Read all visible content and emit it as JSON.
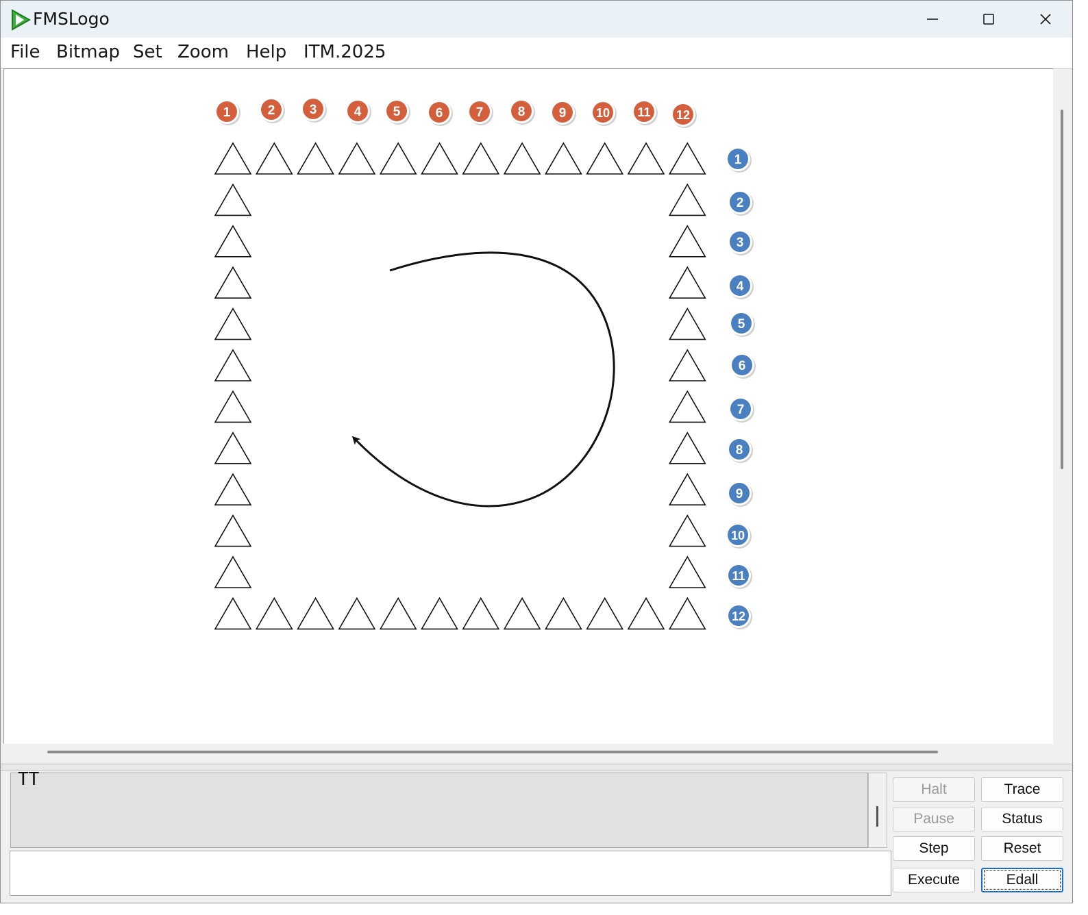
{
  "window": {
    "title": "FMSLogo"
  },
  "menu": [
    "File",
    "Bitmap",
    "Set",
    "Zoom",
    "Help",
    "ITM.2025"
  ],
  "top_badges": [
    "1",
    "2",
    "3",
    "4",
    "5",
    "6",
    "7",
    "8",
    "9",
    "10",
    "11",
    "12"
  ],
  "side_badges": [
    "1",
    "2",
    "3",
    "4",
    "5",
    "6",
    "7",
    "8",
    "9",
    "10",
    "11",
    "12"
  ],
  "colors": {
    "top_badge": "#d35f3d",
    "side_badge": "#4a7fc0"
  },
  "triangle_grid": {
    "columns": 12,
    "rows": 12,
    "shape": "outlined triangles around border"
  },
  "commander": {
    "output_text": "TT",
    "input_value": "",
    "buttons": {
      "halt": "Halt",
      "trace": "Trace",
      "pause": "Pause",
      "status": "Status",
      "step": "Step",
      "reset": "Reset",
      "execute": "Execute",
      "edall": "Edall"
    }
  }
}
